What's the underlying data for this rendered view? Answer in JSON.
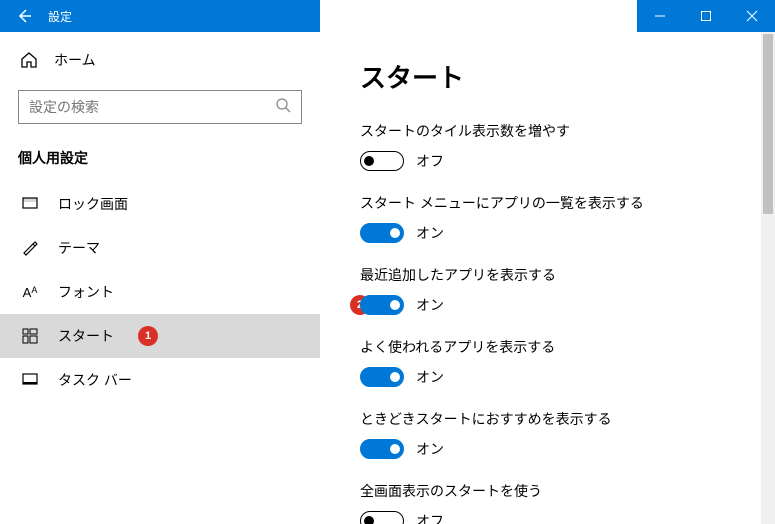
{
  "titlebar": {
    "title": "設定"
  },
  "sidebar": {
    "home": "ホーム",
    "search_placeholder": "設定の検索",
    "section": "個人用設定",
    "items": [
      {
        "label": "ロック画面"
      },
      {
        "label": "テーマ"
      },
      {
        "label": "フォント"
      },
      {
        "label": "スタート"
      },
      {
        "label": "タスク バー"
      }
    ],
    "badge1": "1"
  },
  "main": {
    "heading": "スタート",
    "badge2": "2",
    "settings": [
      {
        "label": "スタートのタイル表示数を増やす",
        "state": "off",
        "text": "オフ"
      },
      {
        "label": "スタート メニューにアプリの一覧を表示する",
        "state": "on",
        "text": "オン"
      },
      {
        "label": "最近追加したアプリを表示する",
        "state": "on",
        "text": "オン"
      },
      {
        "label": "よく使われるアプリを表示する",
        "state": "on",
        "text": "オン"
      },
      {
        "label": "ときどきスタートにおすすめを表示する",
        "state": "on",
        "text": "オン"
      },
      {
        "label": "全画面表示のスタートを使う",
        "state": "off",
        "text": "オフ"
      }
    ]
  }
}
